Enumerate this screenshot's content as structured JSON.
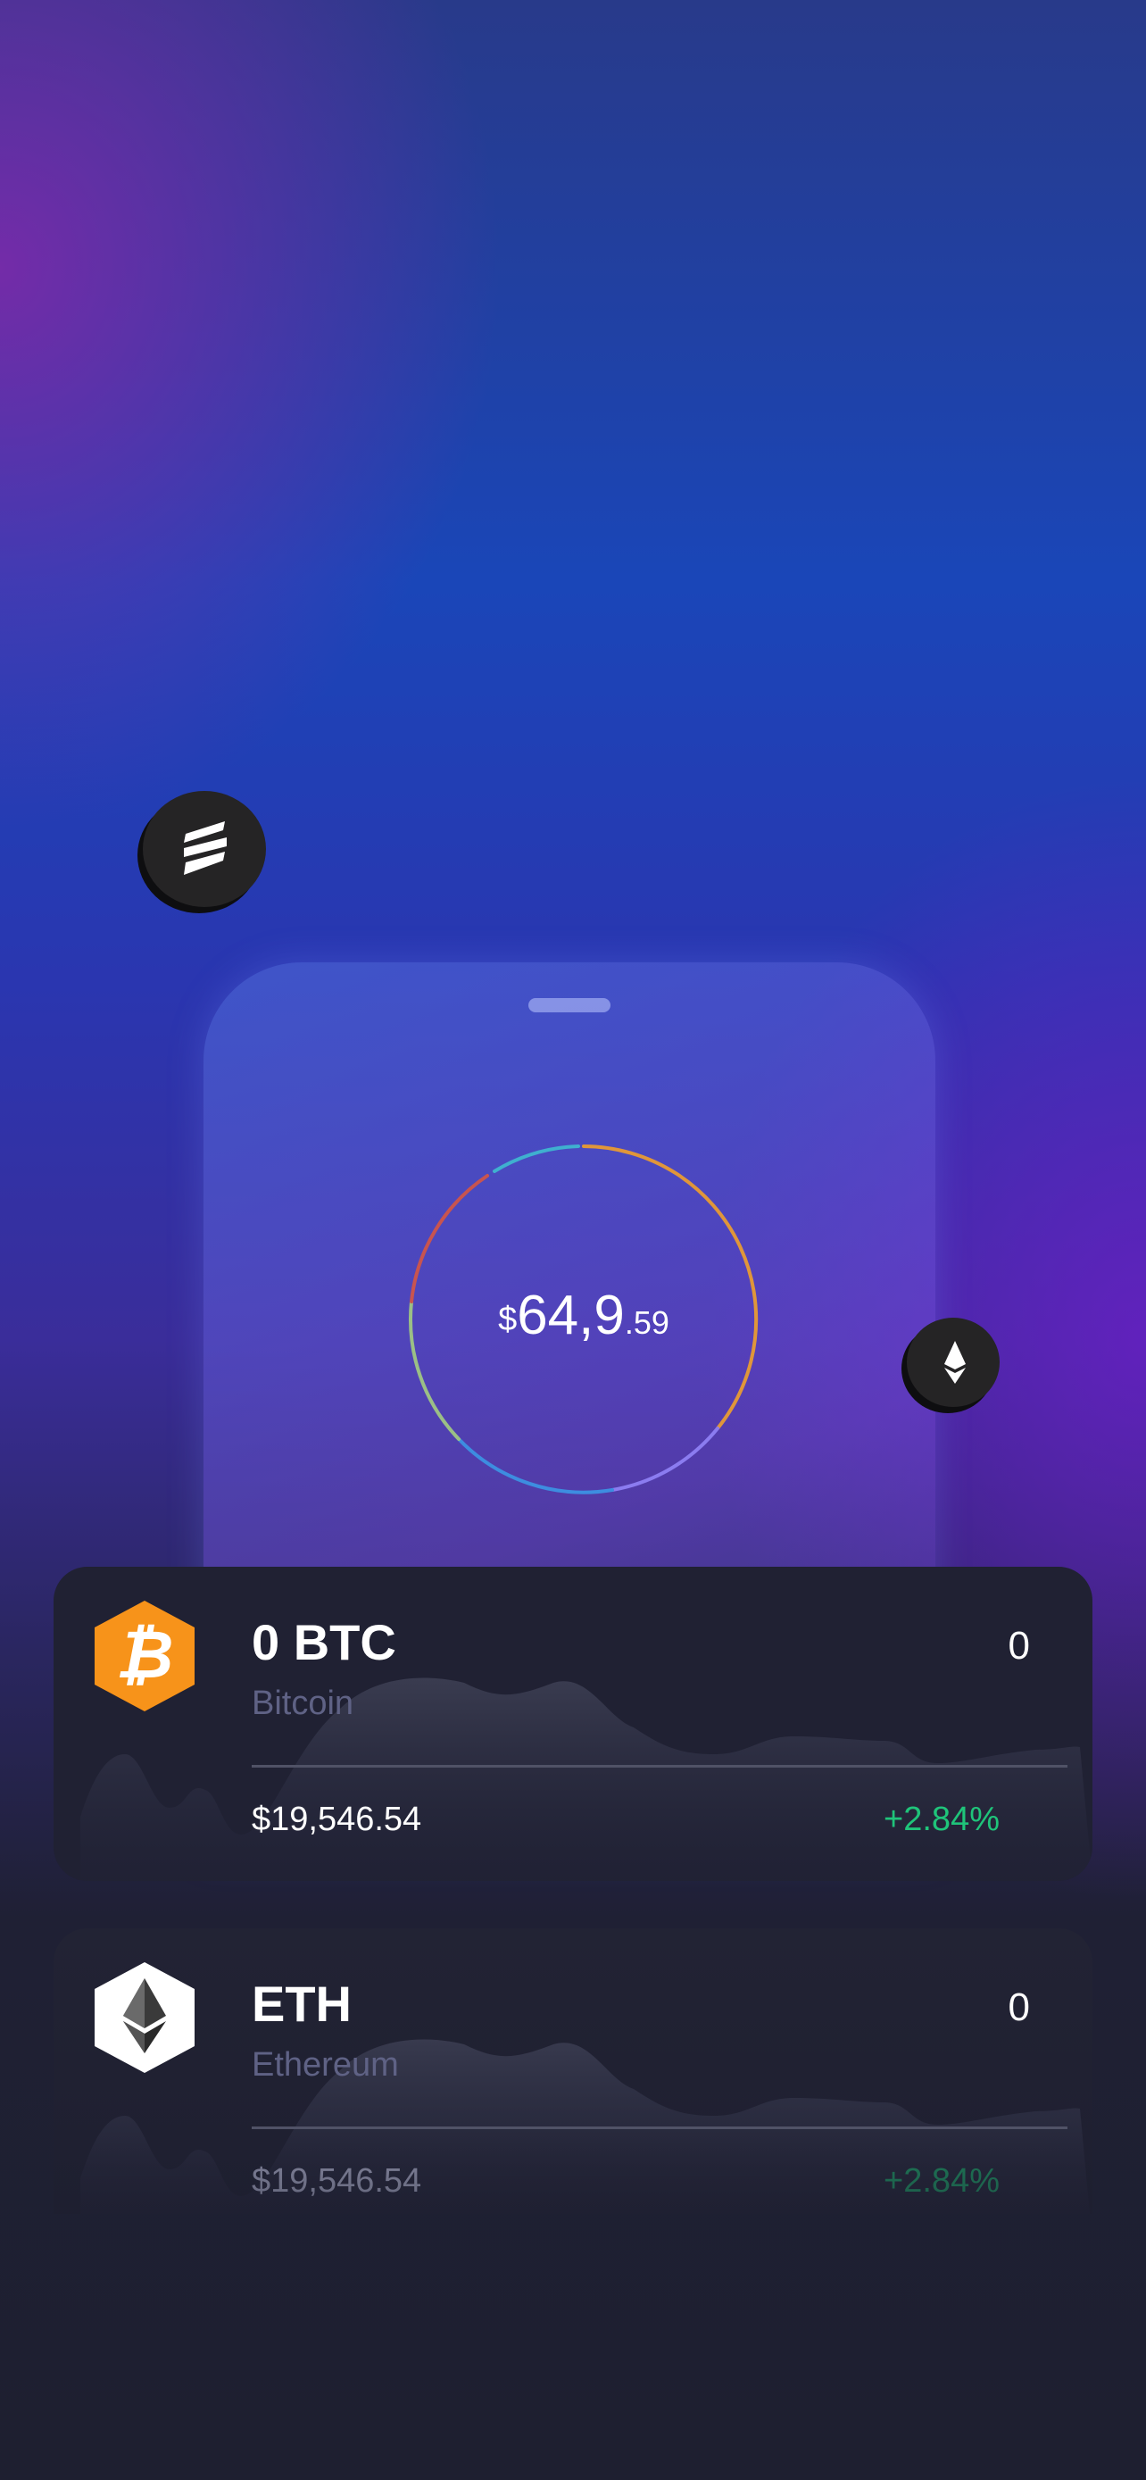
{
  "portfolio": {
    "currency_symbol": "$",
    "balance_main": "64,9",
    "balance_decimals": ".59"
  },
  "colors": {
    "accent_green": "#1fc47a",
    "bitcoin_orange": "#f7931a",
    "card_bg": "#202133"
  },
  "floating_coins": [
    {
      "name": "solana",
      "icon": "solana-icon"
    },
    {
      "name": "ethereum",
      "icon": "ethereum-icon"
    }
  ],
  "assets": [
    {
      "amount": "0 BTC",
      "name": "Bitcoin",
      "quantity": "0",
      "price": "$19,546.54",
      "change": "+2.84%",
      "icon": "bitcoin-icon"
    },
    {
      "amount": "ETH",
      "name": "Ethereum",
      "quantity": "0",
      "price": "$19,546.54",
      "change": "+2.84%",
      "icon": "ethereum-icon"
    }
  ]
}
